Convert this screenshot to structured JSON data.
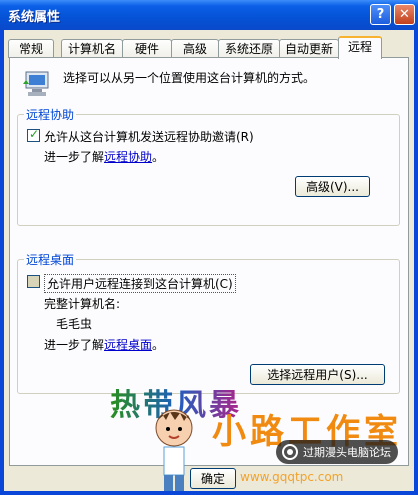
{
  "window": {
    "title": "系统属性",
    "help_label": "?",
    "close_label": "✕"
  },
  "tabs": [
    {
      "label": "常规"
    },
    {
      "label": "计算机名"
    },
    {
      "label": "硬件"
    },
    {
      "label": "高级"
    },
    {
      "label": "系统还原"
    },
    {
      "label": "自动更新"
    },
    {
      "label": "远程"
    }
  ],
  "active_tab": "远程",
  "intro": {
    "text": "选择可以从另一个位置使用这台计算机的方式。"
  },
  "remote_assistance": {
    "title": "远程协助",
    "checkbox_label": "允许从这台计算机发送远程协助邀请(R)",
    "checked": true,
    "learn_prefix": "进一步了解",
    "learn_link": "远程协助",
    "learn_suffix": "。",
    "advanced_button": "高级(V)..."
  },
  "remote_desktop": {
    "title": "远程桌面",
    "checkbox_label": "允许用户远程连接到这台计算机(C)",
    "checked": false,
    "computer_name_label": "完整计算机名:",
    "computer_name_value": "毛毛虫",
    "learn_prefix": "进一步了解",
    "learn_link": "远程桌面",
    "learn_suffix": "。",
    "select_users_button": "选择远程用户(S)..."
  },
  "footer": {
    "ok_button": "确定"
  },
  "overlays": {
    "watermark_text": "热带风暴",
    "brand_text": "小路工作室",
    "brand_url": "www.gqqtpc.com",
    "forum_text": "过期漫头电脑论坛"
  }
}
